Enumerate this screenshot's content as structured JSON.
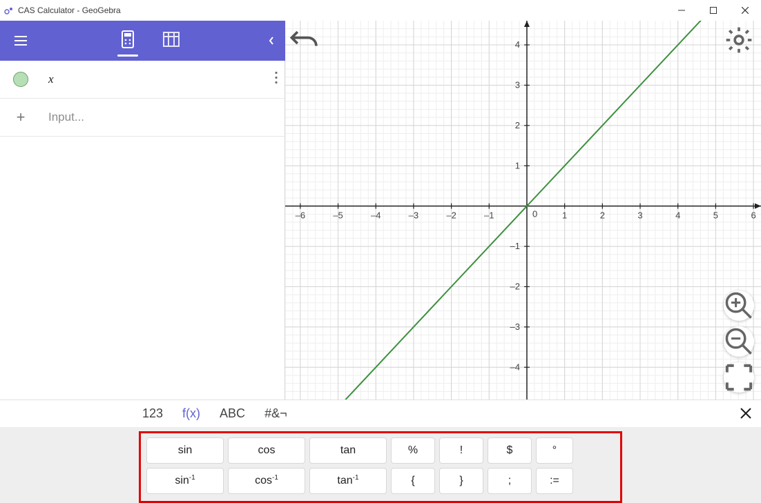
{
  "window": {
    "title": "CAS Calculator - GeoGebra"
  },
  "toolbar": {
    "active_view": "algebra"
  },
  "algebra": {
    "rows": [
      {
        "expr": "x"
      }
    ],
    "input_placeholder": "Input..."
  },
  "graphics": {
    "x_min": -6.4,
    "x_max": 6.2,
    "y_min": -4.8,
    "y_max": 4.6,
    "x_ticks": [
      -6,
      -5,
      -4,
      -3,
      -2,
      -1,
      0,
      1,
      2,
      3,
      4,
      5,
      6
    ],
    "y_ticks": [
      -4,
      -3,
      -2,
      -1,
      1,
      2,
      3,
      4
    ],
    "curve": "y = x",
    "curve_color": "#3f8f3f"
  },
  "keyboard": {
    "tabs": {
      "num": "123",
      "fx": "f(x)",
      "abc": "ABC",
      "sym": "#&¬"
    },
    "active_tab": "fx",
    "rows": [
      [
        {
          "label": "sin",
          "size": "lg"
        },
        {
          "label": "cos",
          "size": "lg"
        },
        {
          "label": "tan",
          "size": "lg"
        },
        {
          "label": "%",
          "size": "md"
        },
        {
          "label": "!",
          "size": "md"
        },
        {
          "label": "$",
          "size": "md"
        },
        {
          "label": "°",
          "size": "sm"
        }
      ],
      [
        {
          "label": "sin⁻¹",
          "size": "lg"
        },
        {
          "label": "cos⁻¹",
          "size": "lg"
        },
        {
          "label": "tan⁻¹",
          "size": "lg"
        },
        {
          "label": "{",
          "size": "md"
        },
        {
          "label": "}",
          "size": "md"
        },
        {
          "label": ";",
          "size": "md"
        },
        {
          "label": ":=",
          "size": "sm"
        }
      ]
    ]
  },
  "chart_data": {
    "type": "line",
    "title": "",
    "xlabel": "",
    "ylabel": "",
    "xlim": [
      -6.4,
      6.2
    ],
    "ylim": [
      -4.8,
      4.6
    ],
    "series": [
      {
        "name": "x",
        "x": [
          -6,
          -5,
          -4,
          -3,
          -2,
          -1,
          0,
          1,
          2,
          3,
          4,
          5,
          6
        ],
        "values": [
          -6,
          -5,
          -4,
          -3,
          -2,
          -1,
          0,
          1,
          2,
          3,
          4,
          5,
          6
        ]
      }
    ]
  }
}
